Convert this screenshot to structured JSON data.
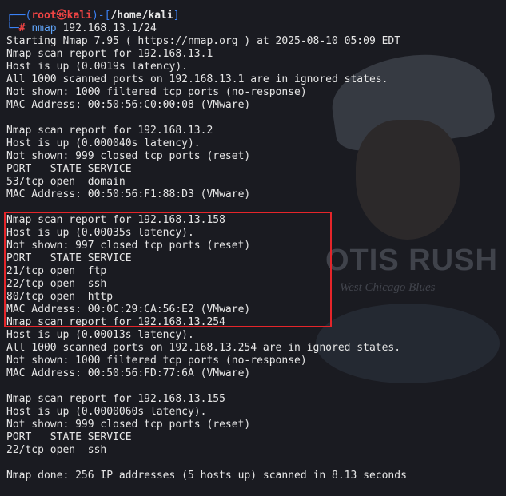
{
  "wallpaper": {
    "title": "OTIS RUSH",
    "subtitle": "West Chicago Blues"
  },
  "prompt": {
    "open": "┌──(",
    "user": "root㉿kali",
    "mid": ")-[",
    "path": "/home/kali",
    "close": "]",
    "second_prefix": "└─",
    "hash": "#",
    "command": "nmap",
    "args": "192.168.13.1/24"
  },
  "output": [
    "Starting Nmap 7.95 ( https://nmap.org ) at 2025-08-10 05:09 EDT",
    "Nmap scan report for 192.168.13.1",
    "Host is up (0.0019s latency).",
    "All 1000 scanned ports on 192.168.13.1 are in ignored states.",
    "Not shown: 1000 filtered tcp ports (no-response)",
    "MAC Address: 00:50:56:C0:00:08 (VMware)",
    "",
    "Nmap scan report for 192.168.13.2",
    "Host is up (0.000040s latency).",
    "Not shown: 999 closed tcp ports (reset)",
    "PORT   STATE SERVICE",
    "53/tcp open  domain",
    "MAC Address: 00:50:56:F1:88:D3 (VMware)",
    "",
    "Nmap scan report for 192.168.13.158",
    "Host is up (0.00035s latency).",
    "Not shown: 997 closed tcp ports (reset)",
    "PORT   STATE SERVICE",
    "21/tcp open  ftp",
    "22/tcp open  ssh",
    "80/tcp open  http",
    "MAC Address: 00:0C:29:CA:56:E2 (VMware)",
    "Nmap scan report for 192.168.13.254",
    "Host is up (0.00013s latency).",
    "All 1000 scanned ports on 192.168.13.254 are in ignored states.",
    "Not shown: 1000 filtered tcp ports (no-response)",
    "MAC Address: 00:50:56:FD:77:6A (VMware)",
    "",
    "Nmap scan report for 192.168.13.155",
    "Host is up (0.0000060s latency).",
    "Not shown: 999 closed tcp ports (reset)",
    "PORT   STATE SERVICE",
    "22/tcp open  ssh",
    "",
    "Nmap done: 256 IP addresses (5 hosts up) scanned in 8.13 seconds"
  ],
  "colors": {
    "background": "#1a1b21",
    "text": "#e6e6e6",
    "prompt_blue": "#3b82f6",
    "prompt_red": "#ef4444",
    "highlight_red": "#e5252a"
  }
}
